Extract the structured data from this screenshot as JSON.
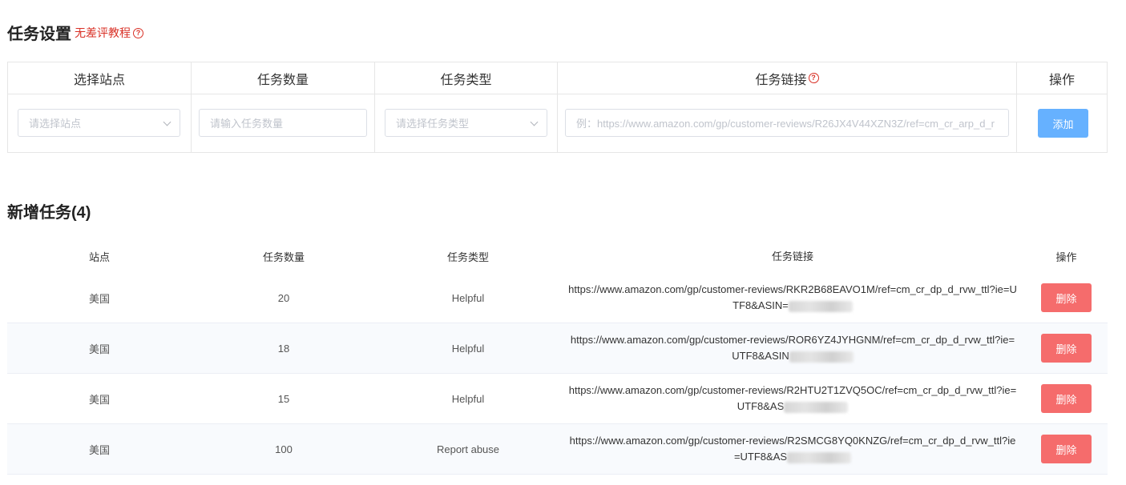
{
  "settings": {
    "title": "任务设置",
    "tutorial_link": "无差评教程",
    "help_glyph": "?",
    "headers": {
      "site": "选择站点",
      "quantity": "任务数量",
      "type": "任务类型",
      "link": "任务链接",
      "operation": "操作"
    },
    "site_placeholder": "请选择站点",
    "quantity_placeholder": "请输入任务数量",
    "type_placeholder": "请选择任务类型",
    "link_placeholder": "例：https://www.amazon.com/gp/customer-reviews/R26JX4V44XZN3Z/ref=cm_cr_arp_d_r",
    "add_label": "添加",
    "colors": {
      "accent": "#66b1ff",
      "danger": "#f56c6c",
      "link_red": "#d93026"
    }
  },
  "tasks": {
    "title": "新增任务(4)",
    "headers": {
      "site": "站点",
      "quantity": "任务数量",
      "type": "任务类型",
      "link": "任务链接",
      "operation": "操作"
    },
    "rows": [
      {
        "site": "美国",
        "quantity": "20",
        "type": "Helpful",
        "link": "https://www.amazon.com/gp/customer-reviews/RKR2B68EAVO1M/ref=cm_cr_dp_d_rvw_ttl?ie=UTF8&ASIN=",
        "delete_label": "删除"
      },
      {
        "site": "美国",
        "quantity": "18",
        "type": "Helpful",
        "link": "https://www.amazon.com/gp/customer-reviews/ROR6YZ4JYHGNM/ref=cm_cr_dp_d_rvw_ttl?ie=UTF8&ASIN",
        "delete_label": "删除"
      },
      {
        "site": "美国",
        "quantity": "15",
        "type": "Helpful",
        "link": "https://www.amazon.com/gp/customer-reviews/R2HTU2T1ZVQ5OC/ref=cm_cr_dp_d_rvw_ttl?ie=UTF8&AS",
        "delete_label": "删除"
      },
      {
        "site": "美国",
        "quantity": "100",
        "type": "Report abuse",
        "link": "https://www.amazon.com/gp/customer-reviews/R2SMCG8YQ0KNZG/ref=cm_cr_dp_d_rvw_ttl?ie=UTF8&AS",
        "delete_label": "删除"
      }
    ]
  }
}
